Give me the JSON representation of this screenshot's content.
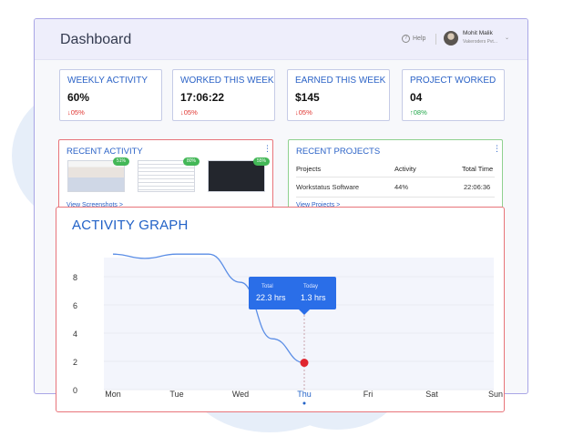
{
  "header": {
    "title": "Dashboard",
    "help_label": "Help",
    "user_name": "Mohit Malik",
    "user_org": "Vakeroders Pvt..."
  },
  "stats": [
    {
      "label": "WEEKLY ACTIVITY",
      "value": "60%",
      "delta": "05%",
      "direction": "down"
    },
    {
      "label": "WORKED THIS WEEK",
      "value": "17:06:22",
      "delta": "05%",
      "direction": "down"
    },
    {
      "label": "EARNED THIS WEEK",
      "value": "$145",
      "delta": "05%",
      "direction": "down"
    },
    {
      "label": "PROJECT WORKED",
      "value": "04",
      "delta": "08%",
      "direction": "up"
    }
  ],
  "recent_activity": {
    "title": "RECENT ACTIVITY",
    "more": "⋮",
    "screenshots": [
      {
        "badge": "51%"
      },
      {
        "badge": "80%"
      },
      {
        "badge": "55%"
      }
    ],
    "link": "View Screenshots >"
  },
  "recent_projects": {
    "title": "RECENT PROJECTS",
    "more": "⋮",
    "columns": [
      "Projects",
      "Activity",
      "Total Time"
    ],
    "rows": [
      [
        "Workstatus Software",
        "44%",
        "22:06:36"
      ]
    ],
    "link": "View Projects >"
  },
  "activity_graph": {
    "title": "ACTIVITY GRAPH",
    "tooltip": {
      "total_label": "Total",
      "total_value": "22.3 hrs",
      "today_label": "Today",
      "today_value": "1.3 hrs"
    }
  },
  "chart_data": {
    "type": "line",
    "title": "ACTIVITY GRAPH",
    "categories": [
      "Mon",
      "Tue",
      "Wed",
      "Thu",
      "Fri",
      "Sat",
      "Sun"
    ],
    "selected_category": "Thu",
    "y_ticks": [
      0,
      2,
      4,
      6,
      8
    ],
    "ylim": [
      0,
      10
    ],
    "series": [
      {
        "x": [
          0,
          0.5,
          1,
          1.5,
          2,
          2.5,
          3
        ],
        "values": [
          9.6,
          9.3,
          9.6,
          9.6,
          7.6,
          3.6,
          1.9
        ]
      }
    ],
    "highlight_point": {
      "category": "Thu",
      "value": 1.9
    },
    "colors": {
      "line": "#5b8ee6",
      "marker": "#e0262f",
      "fill": "#f3f5fc"
    },
    "grid": true
  }
}
